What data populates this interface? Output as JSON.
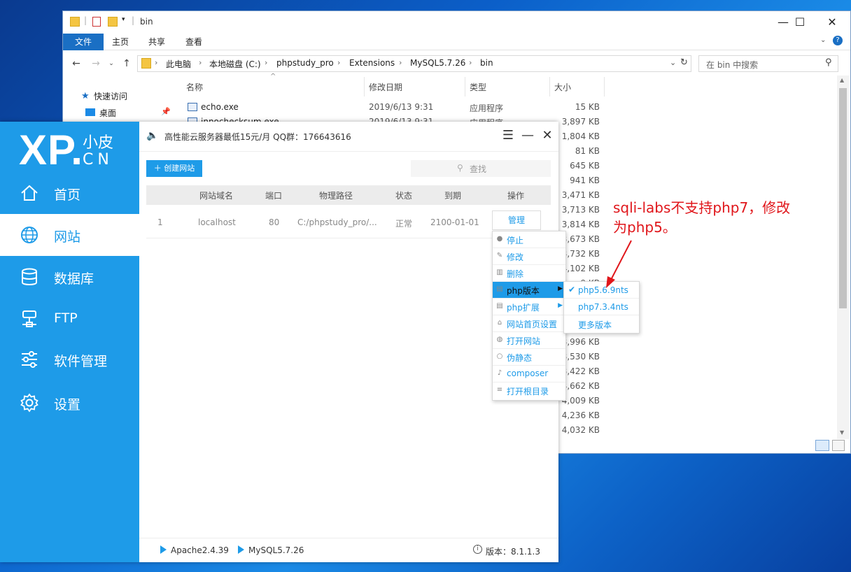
{
  "explorer": {
    "title": "bin",
    "ribbon": {
      "file": "文件",
      "home": "主页",
      "share": "共享",
      "view": "查看"
    },
    "breadcrumb": [
      "此电脑",
      "本地磁盘 (C:)",
      "phpstudy_pro",
      "Extensions",
      "MySQL5.7.26",
      "bin"
    ],
    "search_placeholder": "在 bin 中搜索",
    "nav": {
      "quick_access": "快速访问",
      "desktop": "桌面"
    },
    "columns": {
      "name": "名称",
      "date": "修改日期",
      "type": "类型",
      "size": "大小"
    },
    "rows": [
      {
        "name": "echo.exe",
        "date": "2019/6/13 9:31",
        "type": "应用程序",
        "size": "15 KB"
      },
      {
        "name": "innochecksum.exe",
        "date": "2019/6/13 9:31",
        "type": "应用程序",
        "size": "3,897 KB"
      }
    ],
    "sizes": [
      "1,804 KB",
      "81 KB",
      "645 KB",
      "941 KB",
      "3,471 KB",
      "3,713 KB",
      "3,814 KB",
      "3,673 KB",
      "3,732 KB",
      "4,102 KB",
      "9 KB",
      "3,996 KB",
      "3,530 KB",
      "3,422 KB",
      "4,662 KB",
      "4,009 KB",
      "4,236 KB",
      "4,032 KB"
    ]
  },
  "phpstudy": {
    "logo": {
      "xp": "XP.",
      "cn1": "小皮",
      "cn2": "CN"
    },
    "nav": [
      "首页",
      "网站",
      "数据库",
      "FTP",
      "软件管理",
      "设置"
    ],
    "active_nav_index": 1,
    "notice": "高性能云服务器最低15元/月  QQ群：176643616",
    "create_button": "创建网站",
    "search_placeholder": "查找",
    "table_headers": [
      "网站域名",
      "端口",
      "物理路径",
      "状态",
      "到期",
      "操作"
    ],
    "site": {
      "index": "1",
      "domain": "localhost",
      "port": "80",
      "path": "C:/phpstudy_pro/...",
      "status": "正常",
      "expire": "2100-01-01",
      "action": "管理"
    },
    "status_bar": {
      "apache": "Apache2.4.39",
      "mysql": "MySQL5.7.26",
      "version": "版本：8.1.1.3"
    }
  },
  "context_menu": {
    "items": [
      "停止",
      "修改",
      "删除",
      "php版本",
      "php扩展",
      "网站首页设置",
      "打开网站",
      "伪静态",
      "composer",
      "打开根目录"
    ],
    "highlighted_index": 3,
    "submenu": [
      "php5.6.9nts",
      "php7.3.4nts",
      "更多版本"
    ],
    "submenu_checked_index": 0
  },
  "annotation": {
    "line1": "sqli-labs不支持php7，修改",
    "line2": "为php5。"
  },
  "colors": {
    "brand": "#1e9be8",
    "annotation": "#e0161b"
  }
}
